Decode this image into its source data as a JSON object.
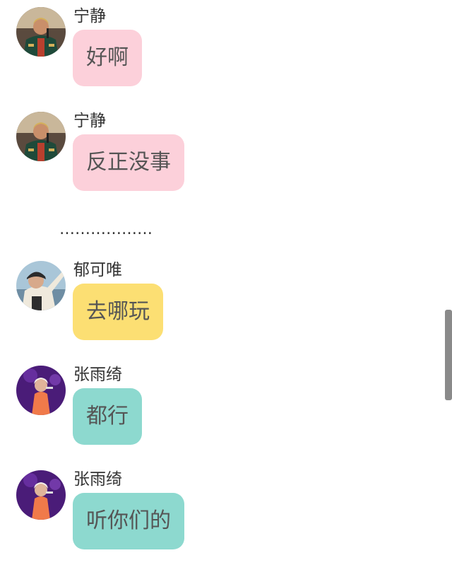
{
  "messages": [
    {
      "name": "宁静",
      "text": "好啊"
    },
    {
      "name": "宁静",
      "text": "反正没事"
    },
    {
      "name": "郁可唯",
      "text": "去哪玩"
    },
    {
      "name": "张雨绮",
      "text": "都行"
    },
    {
      "name": "张雨绮",
      "text": "听你们的"
    }
  ],
  "separator": "………………",
  "colors": {
    "pink_bubble": "#fcd0da",
    "yellow_bubble": "#fcdf73",
    "teal_bubble": "#8dd9cf"
  },
  "avatars": {
    "ningjing": "singer-green-jacket-avatar",
    "yukewei": "singer-white-cap-avatar",
    "zhangyuqi": "singer-orange-dress-avatar"
  }
}
